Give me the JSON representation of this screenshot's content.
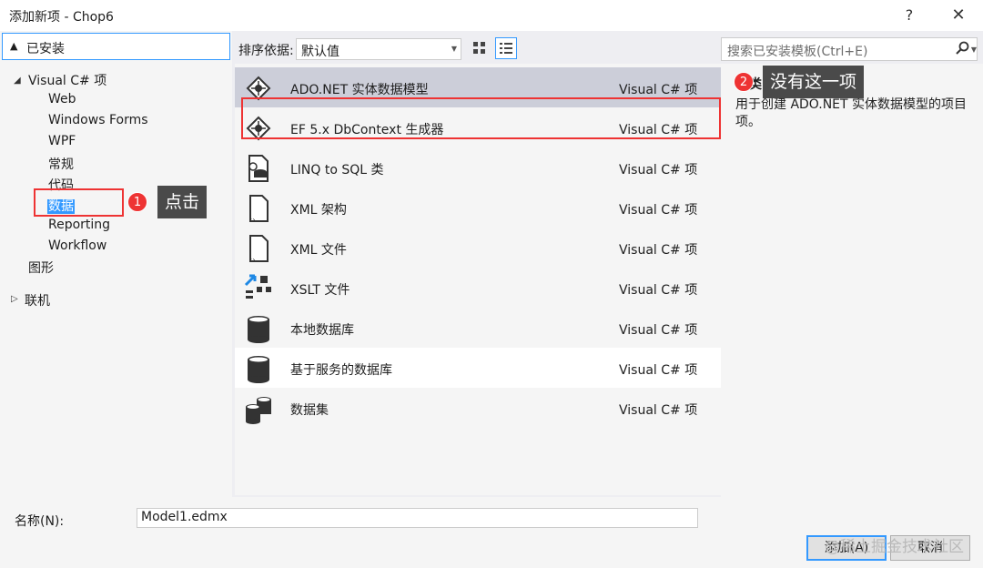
{
  "window": {
    "title": "添加新项 - Chop6",
    "help_label": "?",
    "close_label": "✕"
  },
  "left": {
    "installed_label": "已安装",
    "tree": [
      {
        "label": "Visual C# 项"
      },
      {
        "label": "Web"
      },
      {
        "label": "Windows Forms"
      },
      {
        "label": "WPF"
      },
      {
        "label": "常规"
      },
      {
        "label": "代码"
      },
      {
        "label": "数据"
      },
      {
        "label": "Reporting"
      },
      {
        "label": "Workflow"
      },
      {
        "label": "图形"
      },
      {
        "label": "联机"
      }
    ]
  },
  "toolbar": {
    "sort_label": "排序依据:",
    "sort_value": "默认值",
    "search_placeholder": "搜索已安装模板(Ctrl+E)"
  },
  "templates": [
    {
      "name": "ADO.NET 实体数据模型",
      "type": "Visual C# 项",
      "icon": "entity-model-icon"
    },
    {
      "name": "EF 5.x DbContext 生成器",
      "type": "Visual C# 项",
      "icon": "entity-model-icon"
    },
    {
      "name": "LINQ to SQL 类",
      "type": "Visual C# 项",
      "icon": "linq-icon"
    },
    {
      "name": "XML 架构",
      "type": "Visual C# 项",
      "icon": "xml-file-icon"
    },
    {
      "name": "XML 文件",
      "type": "Visual C# 项",
      "icon": "xml-file-icon"
    },
    {
      "name": "XSLT 文件",
      "type": "Visual C# 项",
      "icon": "xslt-icon"
    },
    {
      "name": "本地数据库",
      "type": "Visual C# 项",
      "icon": "database-icon"
    },
    {
      "name": "基于服务的数据库",
      "type": "Visual C# 项",
      "icon": "database-icon"
    },
    {
      "name": "数据集",
      "type": "Visual C# 项",
      "icon": "dataset-icon"
    }
  ],
  "details": {
    "type_peek": "类",
    "description": "用于创建 ADO.NET 实体数据模型的项目项。"
  },
  "annotations": {
    "badge1": "1",
    "callout1": "点击",
    "badge2": "2",
    "callout2": "没有这一项"
  },
  "bottom": {
    "name_label": "名称(N):",
    "name_value": "Model1.edmx",
    "add_label": "添加(A)",
    "cancel_label": "取消",
    "watermark": "@稀土掘金技术社区"
  },
  "colors": {
    "accent": "#3399ff",
    "annotation_red": "#ee3333",
    "callout_bg": "#4a4a4a",
    "selected_row": "#ccced9"
  }
}
